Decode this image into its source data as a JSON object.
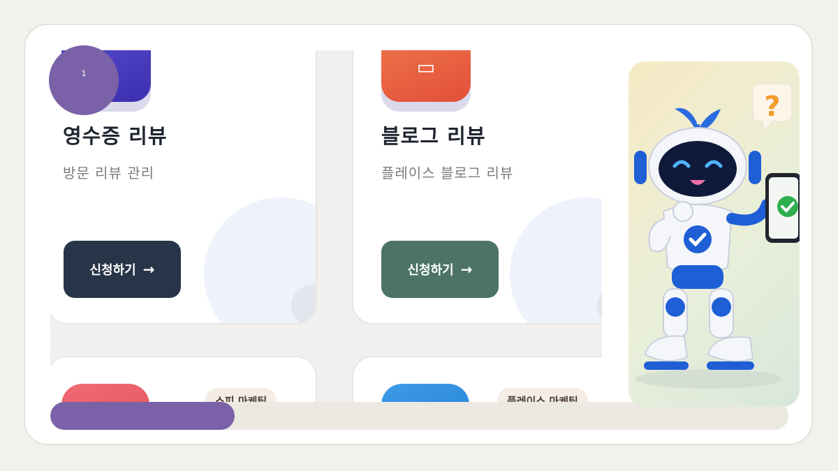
{
  "page_indicator": "1",
  "progress": {
    "value": 0.25
  },
  "cards": [
    {
      "title": "영수증 리뷰",
      "subtitle": "방문 리뷰 관리",
      "button_label": "신청하기",
      "button_arrow": "→",
      "icon": "receipt-icon",
      "icon_color": "#4a3fc2",
      "button_color": "#283548"
    },
    {
      "title": "블로그 리뷰",
      "subtitle": "플레이스 블로그 리뷰",
      "button_label": "신청하기",
      "button_arrow": "→",
      "icon": "blog-icon",
      "icon_color": "#ea6340",
      "button_color": "#4d7368"
    }
  ],
  "bottom_cards": [
    {
      "tag": "스피 마케팅",
      "icon_color": "#e95a66"
    },
    {
      "tag": "플레이스 마케팅",
      "icon_color": "#2f8edf"
    }
  ],
  "mascot": {
    "bubble_symbol": "?",
    "accent": "#1e5fd6",
    "check_color": "#2fae4f"
  }
}
